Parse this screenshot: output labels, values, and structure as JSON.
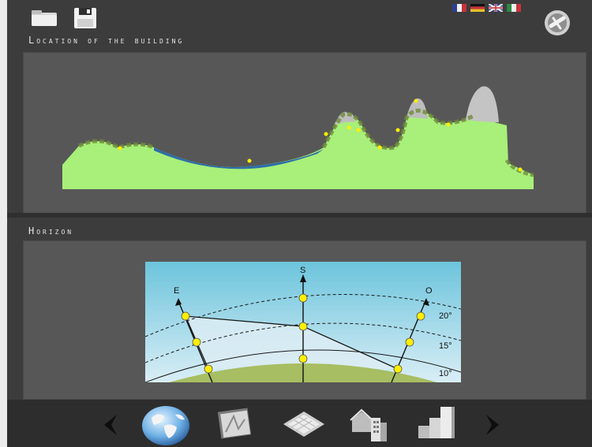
{
  "sections": {
    "location_title": "Location of the building",
    "horizon_title": "Horizon"
  },
  "horizon_chart": {
    "directions": {
      "east": "E",
      "south": "S",
      "west": "O"
    },
    "elevation_labels": [
      "20°",
      "15°",
      "10°"
    ]
  },
  "toolbar": {
    "icons": [
      "folder-icon",
      "save-icon",
      "flag-fr-icon",
      "flag-de-icon",
      "flag-uk-icon",
      "flag-it-icon",
      "settings-icon"
    ]
  },
  "nav": {
    "icons": [
      "prev-arrow-icon",
      "globe-icon",
      "map-icon",
      "calendar-icon",
      "buildings-icon",
      "bar-chart-icon",
      "next-arrow-icon"
    ]
  },
  "colors": {
    "background": "#3c3c3c",
    "panel": "#575757",
    "terrain": "#a8f07a",
    "water": "#2e6ea8",
    "sky_top": "#6cc4dc",
    "sky_bottom": "#cdeaf5",
    "marker": "#ffef00"
  }
}
